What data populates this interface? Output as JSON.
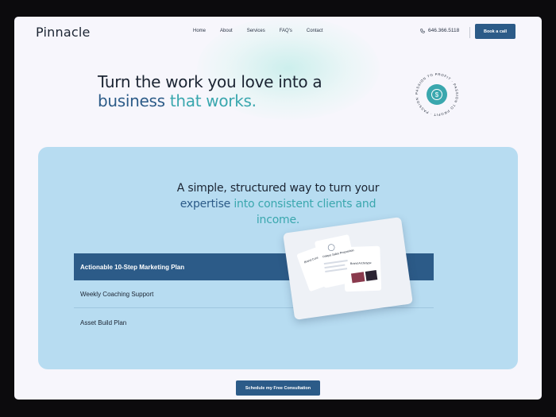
{
  "brand": {
    "logo": "Pinnacle"
  },
  "nav": {
    "items": [
      "Home",
      "About",
      "Services",
      "FAQ's",
      "Contact"
    ]
  },
  "header": {
    "phone": "646.366.5118",
    "book_label": "Book a call"
  },
  "hero": {
    "line1": "Turn the work you love into a",
    "line2_a": "business",
    "line2_b": " that works."
  },
  "badge": {
    "text": "PASSION TO PROFIT · PASSION TO PROFIT · PASSION TO PROFIT ·",
    "symbol": "$"
  },
  "panel": {
    "head_line1": "A simple, structured way to turn your",
    "head_line2_a": "expertise",
    "head_line2_b": " into consistent clients and",
    "head_line3": "income.",
    "features": [
      "Actionable 10-Step Marketing Plan",
      "Weekly Coaching Support",
      "Asset Build Plan"
    ],
    "mock_labels": [
      "Brand Core",
      "Unique Sales Proposition",
      "Brand Archetype"
    ]
  },
  "cta": {
    "label": "Schedule my Free Consultation"
  },
  "colors": {
    "navy": "#2c5b88",
    "teal": "#3aa7ae",
    "panel": "#b7dcf1"
  }
}
